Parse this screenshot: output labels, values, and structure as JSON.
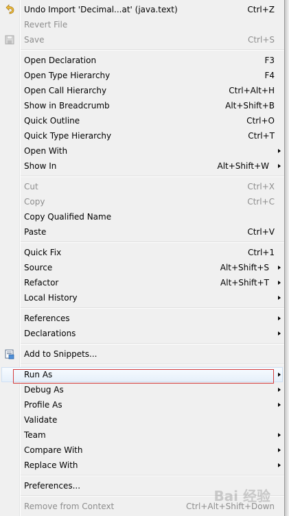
{
  "menu": {
    "items": [
      {
        "label": "Undo Import 'Decimal...at' (java.text)",
        "shortcut": "Ctrl+Z",
        "icon": "undo-icon"
      },
      {
        "label": "Revert File",
        "shortcut": "",
        "disabled": true
      },
      {
        "label": "Save",
        "shortcut": "Ctrl+S",
        "disabled": true,
        "icon": "save-icon"
      },
      {
        "label": "Open Declaration",
        "shortcut": "F3"
      },
      {
        "label": "Open Type Hierarchy",
        "shortcut": "F4"
      },
      {
        "label": "Open Call Hierarchy",
        "shortcut": "Ctrl+Alt+H"
      },
      {
        "label": "Show in Breadcrumb",
        "shortcut": "Alt+Shift+B"
      },
      {
        "label": "Quick Outline",
        "shortcut": "Ctrl+O"
      },
      {
        "label": "Quick Type Hierarchy",
        "shortcut": "Ctrl+T"
      },
      {
        "label": "Open With",
        "shortcut": "",
        "submenu": true
      },
      {
        "label": "Show In",
        "shortcut": "Alt+Shift+W",
        "submenu": true
      },
      {
        "label": "Cut",
        "shortcut": "Ctrl+X",
        "disabled": true
      },
      {
        "label": "Copy",
        "shortcut": "Ctrl+C",
        "disabled": true
      },
      {
        "label": "Copy Qualified Name",
        "shortcut": ""
      },
      {
        "label": "Paste",
        "shortcut": "Ctrl+V"
      },
      {
        "label": "Quick Fix",
        "shortcut": "Ctrl+1"
      },
      {
        "label": "Source",
        "shortcut": "Alt+Shift+S",
        "submenu": true
      },
      {
        "label": "Refactor",
        "shortcut": "Alt+Shift+T",
        "submenu": true
      },
      {
        "label": "Local History",
        "shortcut": "",
        "submenu": true
      },
      {
        "label": "References",
        "shortcut": "",
        "submenu": true
      },
      {
        "label": "Declarations",
        "shortcut": "",
        "submenu": true
      },
      {
        "label": "Add to Snippets...",
        "shortcut": "",
        "icon": "snippets-icon"
      },
      {
        "label": "Run As",
        "shortcut": "",
        "submenu": true,
        "highlighted": true
      },
      {
        "label": "Debug As",
        "shortcut": "",
        "submenu": true
      },
      {
        "label": "Profile As",
        "shortcut": "",
        "submenu": true
      },
      {
        "label": "Validate",
        "shortcut": ""
      },
      {
        "label": "Team",
        "shortcut": "",
        "submenu": true
      },
      {
        "label": "Compare With",
        "shortcut": "",
        "submenu": true
      },
      {
        "label": "Replace With",
        "shortcut": "",
        "submenu": true
      },
      {
        "label": "Preferences...",
        "shortcut": ""
      },
      {
        "label": "Remove from Context",
        "shortcut": "Ctrl+Alt+Shift+Down",
        "disabled": true
      }
    ]
  },
  "watermark": "Bai 经验"
}
